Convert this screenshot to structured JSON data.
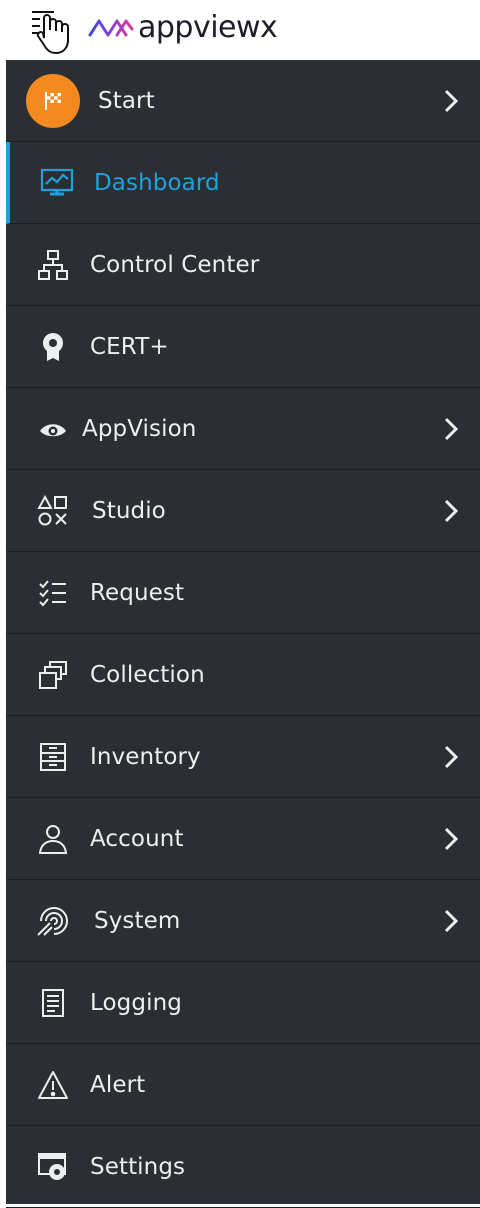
{
  "brand": {
    "logo_text": "appviewx"
  },
  "colors": {
    "sidebar_bg": "#2b2e33",
    "active": "#1aa3dc",
    "start_badge": "#f28a1f"
  },
  "nav": [
    {
      "label": "Start",
      "icon": "flag-icon",
      "chevron": true
    },
    {
      "label": "Dashboard",
      "icon": "monitor-icon",
      "chevron": false,
      "active": true
    },
    {
      "label": "Control Center",
      "icon": "hierarchy-icon",
      "chevron": false
    },
    {
      "label": "CERT+",
      "icon": "certificate-icon",
      "chevron": false
    },
    {
      "label": "AppVision",
      "icon": "eye-icon",
      "chevron": true
    },
    {
      "label": "Studio",
      "icon": "shapes-icon",
      "chevron": true
    },
    {
      "label": "Request",
      "icon": "checklist-icon",
      "chevron": false
    },
    {
      "label": "Collection",
      "icon": "collection-icon",
      "chevron": false
    },
    {
      "label": "Inventory",
      "icon": "inventory-icon",
      "chevron": true
    },
    {
      "label": "Account",
      "icon": "user-icon",
      "chevron": true
    },
    {
      "label": "System",
      "icon": "system-icon",
      "chevron": true
    },
    {
      "label": "Logging",
      "icon": "log-icon",
      "chevron": false
    },
    {
      "label": "Alert",
      "icon": "alert-icon",
      "chevron": false
    },
    {
      "label": "Settings",
      "icon": "settings-icon",
      "chevron": false
    }
  ]
}
